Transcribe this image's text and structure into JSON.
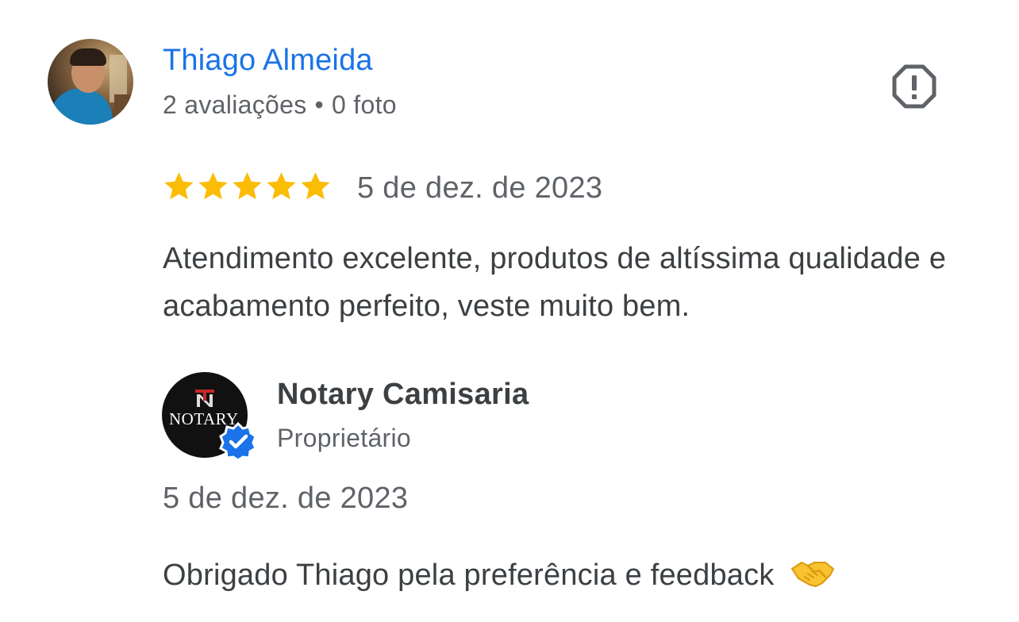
{
  "review": {
    "author_name": "Thiago Almeida",
    "reviews_count": "2 avaliações",
    "separator": "•",
    "photos_count": "0 foto",
    "rating": 5,
    "max_rating": 5,
    "date": "5 de dez. de 2023",
    "text": "Atendimento excelente, produtos de altíssima qualidade e acabamento perfeito, veste muito bem."
  },
  "owner_reply": {
    "name": "Notary Camisaria",
    "role": "Proprietário",
    "logo_text": "NOTARY",
    "date": "5 de dez. de 2023",
    "text": "Obrigado Thiago pela preferência e feedback",
    "emoji_icon": "handshake-icon"
  },
  "colors": {
    "author_name": "#1a73e8",
    "star": "#fbbc04",
    "verified": "#1a73e8",
    "secondary_text": "#5f6368",
    "primary_text": "#3c4043"
  },
  "icons": {
    "report": "flag-report-icon",
    "star": "star-icon",
    "verified": "verified-badge-icon"
  }
}
